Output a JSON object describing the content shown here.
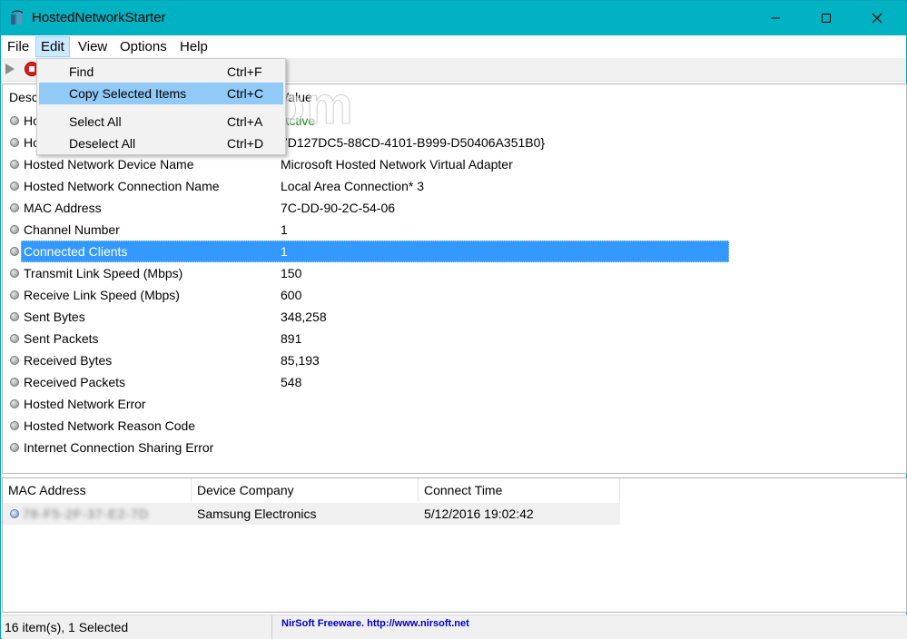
{
  "window": {
    "title": "HostedNetworkStarter",
    "minimize": "—",
    "maximize": "☐",
    "close": "✕"
  },
  "menubar": {
    "file": "File",
    "edit": "Edit",
    "view": "View",
    "options": "Options",
    "help": "Help"
  },
  "toolbar": {
    "start_icon": "play-icon",
    "stop_icon": "stop-icon"
  },
  "edit_menu": [
    {
      "label": "Find",
      "shortcut": "Ctrl+F"
    },
    {
      "label": "Copy Selected Items",
      "shortcut": "Ctrl+C"
    },
    {
      "label": "Select All",
      "shortcut": "Ctrl+A"
    },
    {
      "label": "Deselect All",
      "shortcut": "Ctrl+D"
    }
  ],
  "upper_list": {
    "col_description": "Desc",
    "col_value": "Value",
    "rows": [
      {
        "desc": "Ho",
        "value": "Active"
      },
      {
        "desc": "Ho",
        "value": "7D127DC5-88CD-4101-B999-D50406A351B0}"
      },
      {
        "desc": "Hosted Network Device Name",
        "value": "Microsoft Hosted Network Virtual Adapter"
      },
      {
        "desc": "Hosted Network Connection Name",
        "value": "Local Area Connection* 3"
      },
      {
        "desc": "MAC Address",
        "value": "7C-DD-90-2C-54-06"
      },
      {
        "desc": "Channel Number",
        "value": "1"
      },
      {
        "desc": "Connected Clients",
        "value": "1"
      },
      {
        "desc": "Transmit Link Speed (Mbps)",
        "value": "150"
      },
      {
        "desc": "Receive Link Speed (Mbps)",
        "value": "600"
      },
      {
        "desc": "Sent Bytes",
        "value": "348,258"
      },
      {
        "desc": "Sent Packets",
        "value": "891"
      },
      {
        "desc": "Received Bytes",
        "value": "85,193"
      },
      {
        "desc": "Received Packets",
        "value": "548"
      },
      {
        "desc": "Hosted Network Error",
        "value": ""
      },
      {
        "desc": "Hosted Network Reason Code",
        "value": ""
      },
      {
        "desc": "Internet Connection Sharing Error",
        "value": ""
      }
    ]
  },
  "lower_list": {
    "headers": {
      "mac": "MAC Address",
      "company": "Device Company",
      "time": "Connect Time"
    },
    "rows": [
      {
        "mac": "78-F5-2F-37-E2-7D",
        "company": "Samsung Electronics",
        "time": "5/12/2016 19:02:42"
      }
    ]
  },
  "statusbar": {
    "count": "16 item(s), 1 Selected",
    "link": "NirSoft Freeware.  http://www.nirsoft.net"
  },
  "watermark": "SoftPD.com"
}
